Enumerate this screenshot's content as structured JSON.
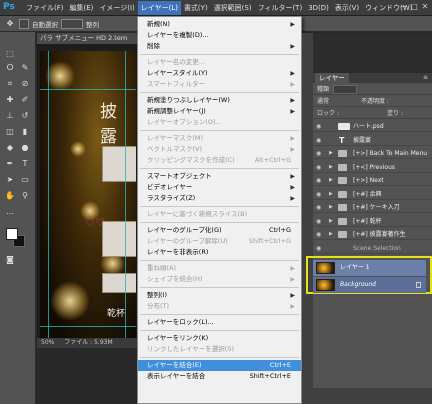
{
  "app": {
    "logo": "Ps"
  },
  "menubar": {
    "items": [
      "ファイル(F)",
      "編集(E)",
      "イメージ(I)",
      "レイヤー(L)",
      "書式(Y)",
      "選択範囲(S)",
      "フィルター(T)",
      "3D(D)",
      "表示(V)",
      "ウィンドウ(W)"
    ],
    "active_index": 3,
    "controls": [
      "−",
      "□",
      "✕"
    ]
  },
  "optionsbar": {
    "label": "自動選択",
    "extra": "整列",
    "mode": "3D"
  },
  "document": {
    "tab_title": "パラ サブメニュー HD 2.tem",
    "canvas_title": "披露",
    "canvas_sub": "乾杯",
    "status_zoom": "50%",
    "status_file": "ファイル : 5.93M"
  },
  "layer_menu": {
    "items": [
      {
        "label": "新規(N)",
        "submenu": true,
        "disabled": false
      },
      {
        "label": "レイヤーを複製(D)...",
        "disabled": false
      },
      {
        "label": "削除",
        "submenu": true,
        "disabled": false
      },
      {
        "sep": true
      },
      {
        "label": "レイヤー名の変更...",
        "disabled": true
      },
      {
        "label": "レイヤースタイル(Y)",
        "submenu": true,
        "disabled": false
      },
      {
        "label": "スマートフィルター",
        "submenu": true,
        "disabled": true
      },
      {
        "sep": true
      },
      {
        "label": "新規塗りつぶしレイヤー(W)",
        "submenu": true,
        "disabled": false
      },
      {
        "label": "新規調整レイヤー(J)",
        "submenu": true,
        "disabled": false
      },
      {
        "label": "レイヤーオプション(O)...",
        "disabled": true
      },
      {
        "sep": true
      },
      {
        "label": "レイヤーマスク(M)",
        "submenu": true,
        "disabled": true
      },
      {
        "label": "ベクトルマスク(V)",
        "submenu": true,
        "disabled": true
      },
      {
        "label": "クリッピングマスクを作成(C)",
        "shortcut": "Alt+Ctrl+G",
        "disabled": true
      },
      {
        "sep": true
      },
      {
        "label": "スマートオブジェクト",
        "submenu": true,
        "disabled": false
      },
      {
        "label": "ビデオレイヤー",
        "submenu": true,
        "disabled": false
      },
      {
        "label": "ラスタライズ(Z)",
        "submenu": true,
        "disabled": false
      },
      {
        "sep": true
      },
      {
        "label": "レイヤーに基づく新規スライス(B)",
        "disabled": true
      },
      {
        "sep": true
      },
      {
        "label": "レイヤーのグループ化(G)",
        "shortcut": "Ctrl+G",
        "disabled": false
      },
      {
        "label": "レイヤーのグループ解除(U)",
        "shortcut": "Shift+Ctrl+G",
        "disabled": true
      },
      {
        "label": "レイヤーを非表示(R)",
        "disabled": false
      },
      {
        "sep": true
      },
      {
        "label": "重ね順(A)",
        "submenu": true,
        "disabled": true
      },
      {
        "label": "シェイプを結合(H)",
        "submenu": true,
        "disabled": true
      },
      {
        "sep": true
      },
      {
        "label": "整列(I)",
        "submenu": true,
        "disabled": false
      },
      {
        "label": "分布(T)",
        "submenu": true,
        "disabled": true
      },
      {
        "sep": true
      },
      {
        "label": "レイヤーをロック(L)...",
        "disabled": false
      },
      {
        "sep": true
      },
      {
        "label": "レイヤーをリンク(K)",
        "disabled": false
      },
      {
        "label": "リンクしたレイヤーを選択(S)",
        "disabled": true
      },
      {
        "sep": true
      },
      {
        "label": "レイヤーを結合(E)",
        "shortcut": "Ctrl+E",
        "disabled": false,
        "highlighted": true
      },
      {
        "label": "表示レイヤーを結合",
        "shortcut": "Shift+Ctrl+E",
        "disabled": false
      }
    ]
  },
  "layers_panel": {
    "tab": "レイヤー",
    "kind_label": "種類",
    "mode": "通常",
    "opacity_label": "不透明度 :",
    "lock_label": "ロック :",
    "fill_label": "塗り :",
    "layers": [
      {
        "name": "ハート.psd",
        "type": "image"
      },
      {
        "name": "披露宴",
        "type": "text"
      },
      {
        "name": "[+>] Back To Main Menu",
        "type": "folder"
      },
      {
        "name": "[+<] Previous",
        "type": "folder"
      },
      {
        "name": "[+>] Next",
        "type": "folder"
      },
      {
        "name": "[+#] 余興",
        "type": "folder"
      },
      {
        "name": "[+#] ケーキ入刀",
        "type": "folder"
      },
      {
        "name": "[+#] 乾杯",
        "type": "folder"
      },
      {
        "name": "[+#] 披露宴著作生",
        "type": "folder"
      },
      {
        "name": "Scene Selection",
        "type": "text-small"
      }
    ],
    "selected_layers": [
      {
        "name": "レイヤー 1",
        "locked": false
      },
      {
        "name": "Background",
        "locked": true
      }
    ]
  },
  "colors": {
    "menu_highlight": "#3f8fdc",
    "selection_frame": "#e5e21c",
    "guide": "#24b7c6"
  }
}
